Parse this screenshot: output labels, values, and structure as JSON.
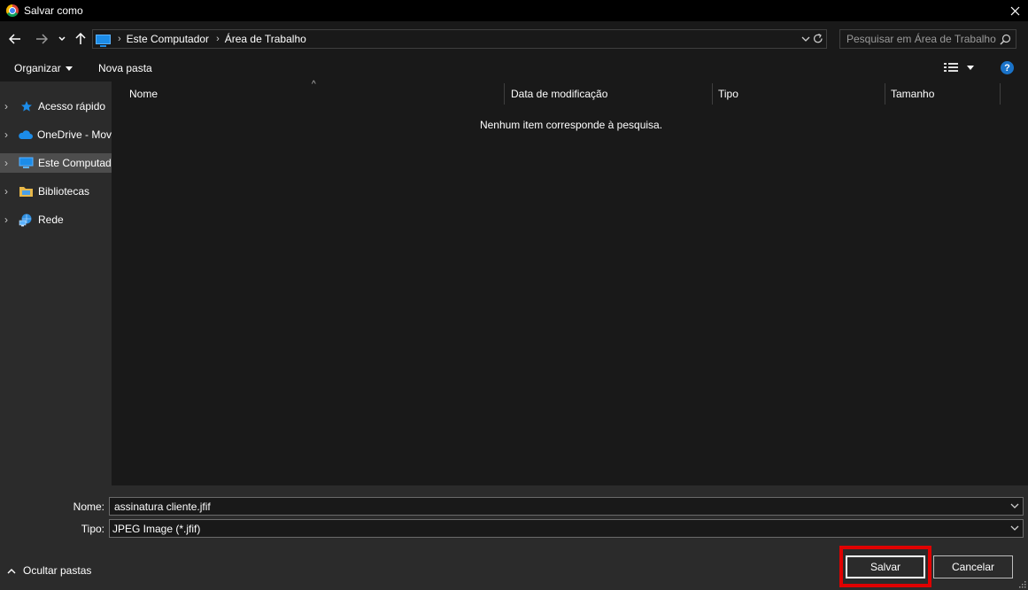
{
  "window": {
    "title": "Salvar como"
  },
  "address": {
    "crumbs": [
      "Este Computador",
      "Área de Trabalho"
    ],
    "search_placeholder": "Pesquisar em Área de Trabalho"
  },
  "toolbar": {
    "organize_label": "Organizar",
    "new_folder_label": "Nova pasta",
    "help_label": "?"
  },
  "sidebar": {
    "items": [
      {
        "label": "Acesso rápido",
        "icon": "star-icon"
      },
      {
        "label": "OneDrive - Mov",
        "icon": "cloud-icon"
      },
      {
        "label": "Este Computad",
        "icon": "computer-icon",
        "selected": true
      },
      {
        "label": "Bibliotecas",
        "icon": "library-folder-icon"
      },
      {
        "label": "Rede",
        "icon": "network-icon"
      }
    ]
  },
  "list": {
    "columns": [
      "Nome",
      "Data de modificação",
      "Tipo",
      "Tamanho"
    ],
    "empty_message": "Nenhum item corresponde à pesquisa."
  },
  "form": {
    "name_label": "Nome:",
    "name_value": "assinatura cliente.jfif",
    "type_label": "Tipo:",
    "type_value": "JPEG Image (*.jfif)"
  },
  "footer": {
    "hide_folders_label": "Ocultar pastas",
    "save_label": "Salvar",
    "cancel_label": "Cancelar"
  },
  "colors": {
    "highlight": "#e00000",
    "accent": "#1c8ce8"
  }
}
